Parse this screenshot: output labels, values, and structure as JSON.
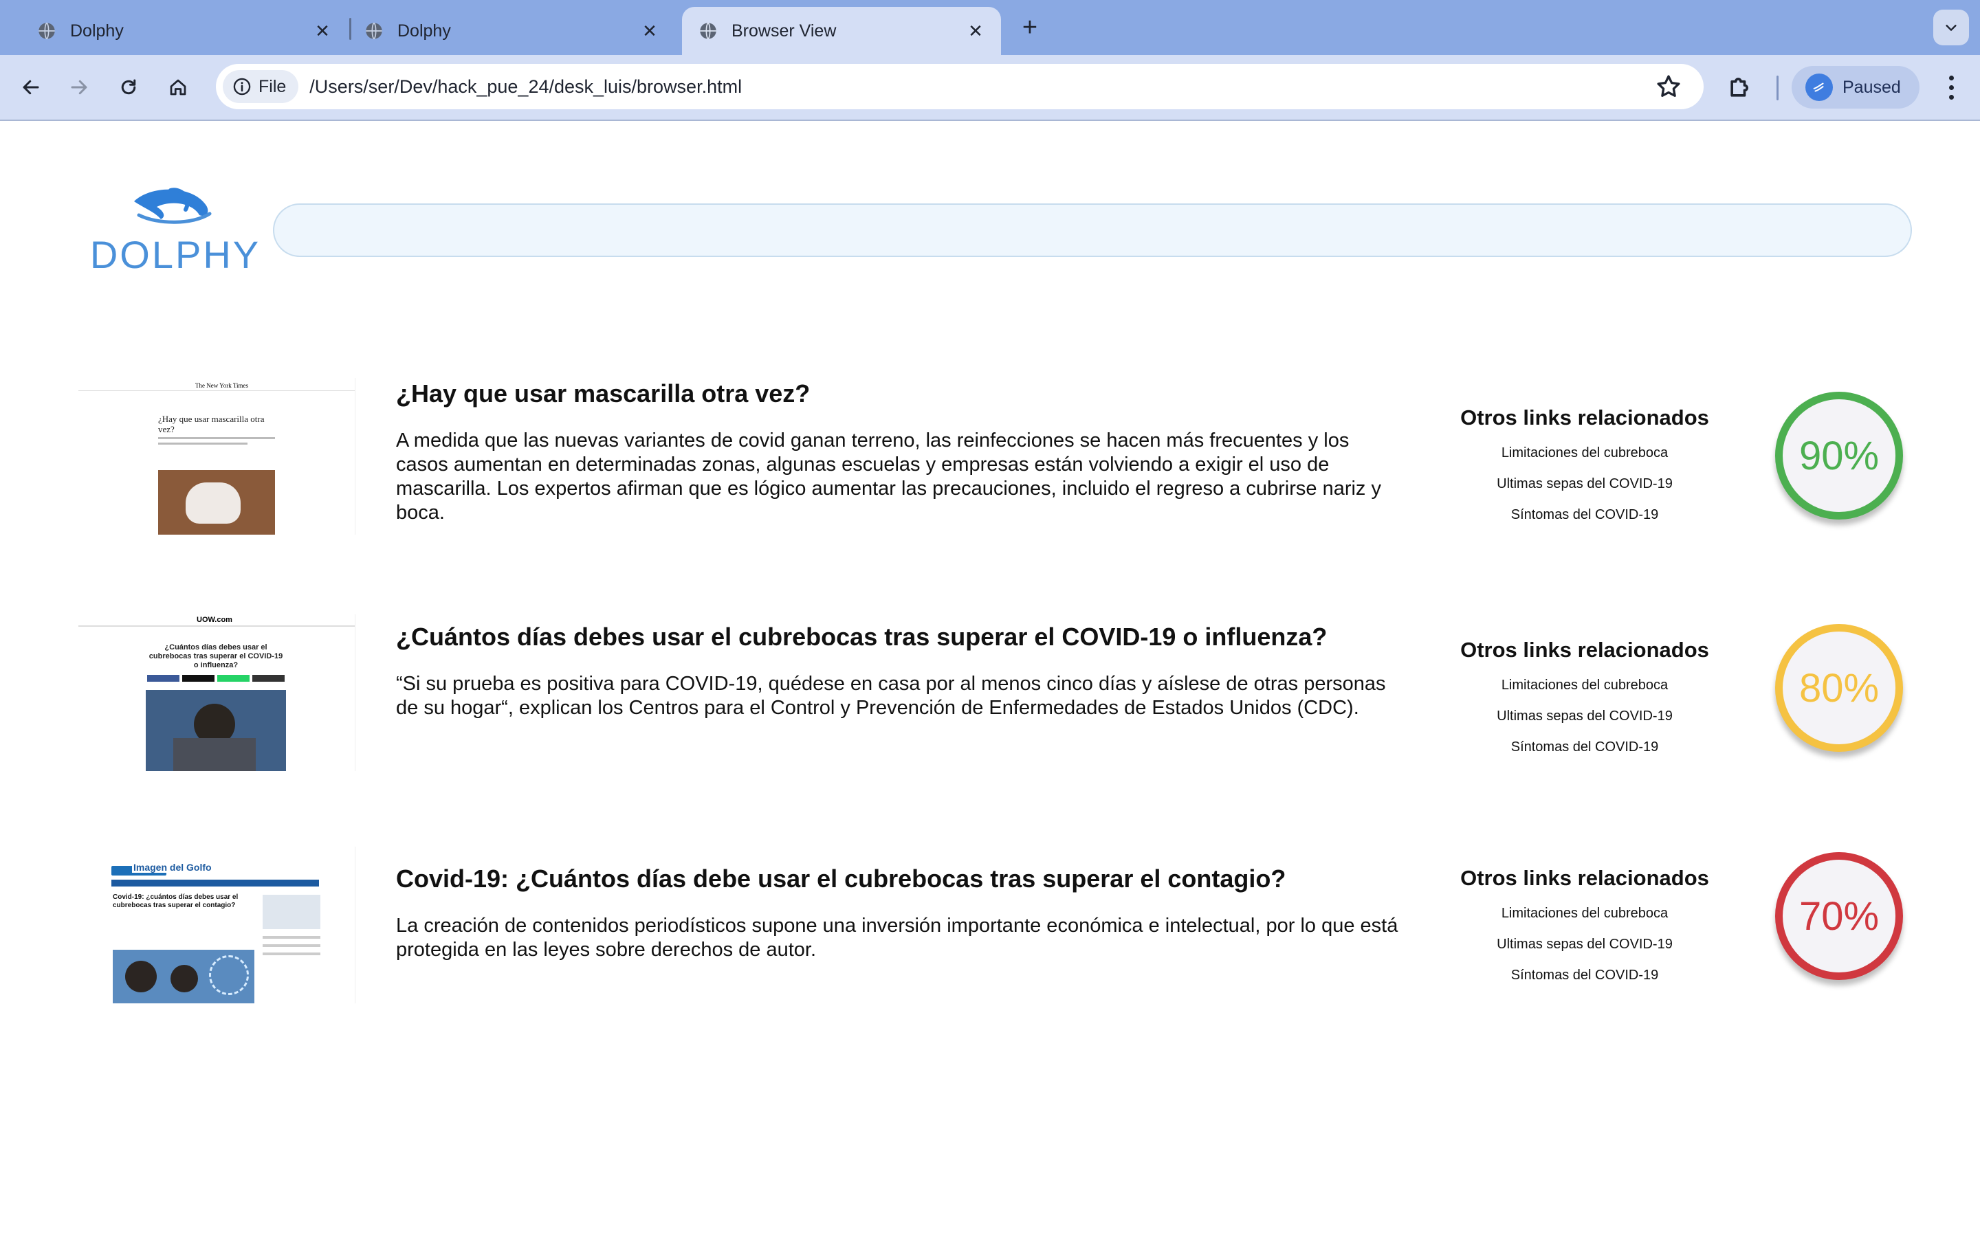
{
  "browser": {
    "tabs": [
      {
        "title": "Dolphy",
        "active": false
      },
      {
        "title": "Dolphy",
        "active": false
      },
      {
        "title": "Browser View",
        "active": true
      }
    ],
    "address": {
      "chip": "File",
      "url": "/Users/ser/Dev/hack_pue_24/desk_luis/browser.html"
    },
    "profile_label": "Paused"
  },
  "app": {
    "logo_text": "DOLPHY",
    "search_value": ""
  },
  "results": [
    {
      "title": "¿Hay que usar mascarilla otra vez?",
      "description": "A medida que las nuevas variantes de covid ganan terreno, las reinfecciones se hacen más frecuentes y los casos aumentan en determinadas zonas, algunas escuelas y empresas están volviendo a exigir el uso de mascarilla. Los expertos afirman que es lógico aumentar las precauciones, incluido el regreso a cubrirse nariz y boca.",
      "related_heading": "Otros links relacionados",
      "related_links": [
        "Limitaciones del cubreboca",
        "Ultimas sepas del COVID-19",
        "Síntomas del COVID-19"
      ],
      "score": "90%",
      "score_color": "#4caf50",
      "thumb": {
        "masthead": "The New York Times",
        "headline": "¿Hay que usar mascarilla otra vez?"
      }
    },
    {
      "title": "¿Cuántos días debes usar el cubrebocas tras superar el COVID-19 o influenza?",
      "description": "“Si su prueba es positiva para COVID-19, quédese en casa por al menos cinco días y aíslese de otras personas de su hogar“, explican los Centros para el Control y Prevención de Enfermedades de Estados Unidos (CDC).",
      "related_heading": "Otros links relacionados",
      "related_links": [
        "Limitaciones del cubreboca",
        "Ultimas sepas del COVID-19",
        "Síntomas del COVID-19"
      ],
      "score": "80%",
      "score_color": "#f5c242",
      "thumb": {
        "masthead": "UOW.com",
        "headline": "¿Cuántos días debes usar el cubrebocas tras superar el COVID-19 o influenza?"
      }
    },
    {
      "title": "Covid-19: ¿Cuántos días debe usar el cubrebocas tras superar el contagio?",
      "description": "La creación de contenidos periodísticos supone una inversión importante económica e intelectual, por lo que está protegida en las leyes sobre derechos de autor.",
      "related_heading": "Otros links relacionados",
      "related_links": [
        "Limitaciones del cubreboca",
        "Ultimas sepas del COVID-19",
        "Síntomas del COVID-19"
      ],
      "score": "70%",
      "score_color": "#d0383f",
      "thumb": {
        "masthead": "Imagen del Golfo",
        "headline": "Covid-19: ¿cuántos días debes usar el cubrebocas tras superar el contagio?"
      }
    }
  ]
}
